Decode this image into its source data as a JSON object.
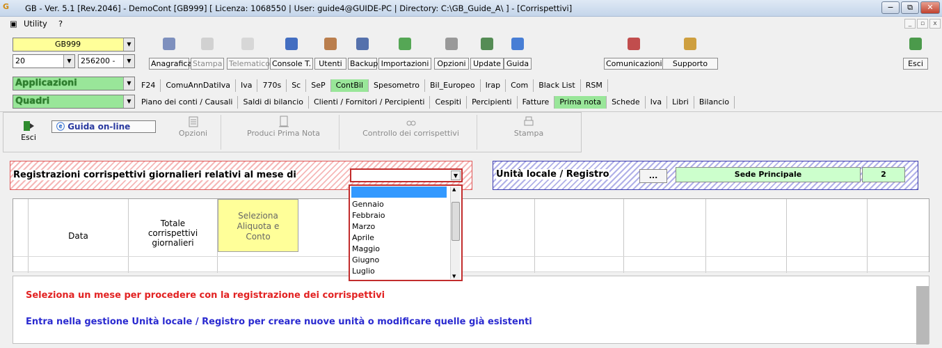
{
  "window": {
    "title": "GB - Ver. 5.1 [Rev.2046] -  DemoCont [GB999]     [ Licenza: 1068550 | User: guide4@GUIDE-PC | Directory: C:\\GB_Guide_A\\ ] - [Corrispettivi]",
    "app_icon_text": "G",
    "minimize": "−",
    "maximize": "⧉",
    "close": "✕"
  },
  "menubar": {
    "utility": "Utility",
    "help": "?"
  },
  "selectors": {
    "company": "GB999",
    "year": "20",
    "code": "256200 -",
    "applicazioni": "Applicazioni",
    "quadri": "Quadri"
  },
  "toolbar": [
    {
      "label": "Anagrafica",
      "icon": "address-book-icon",
      "state": "enabled"
    },
    {
      "label": "Stampa",
      "icon": "printer-icon",
      "state": "disabled"
    },
    {
      "label": "Telematico",
      "icon": "send-icon",
      "state": "disabled"
    },
    {
      "label": "Console T.",
      "icon": "console-icon",
      "state": "enabled"
    },
    {
      "label": "Utenti",
      "icon": "users-icon",
      "state": "enabled"
    },
    {
      "label": "Backup",
      "icon": "backup-icon",
      "state": "enabled"
    },
    {
      "label": "Importazioni",
      "icon": "import-icon",
      "state": "enabled"
    },
    {
      "label": "Opzioni",
      "icon": "wrench-icon",
      "state": "enabled"
    },
    {
      "label": "Update",
      "icon": "update-icon",
      "state": "enabled"
    },
    {
      "label": "Guida",
      "icon": "help-icon",
      "state": "enabled"
    },
    {
      "label": "Comunicazioni",
      "icon": "communication-icon",
      "state": "enabled"
    },
    {
      "label": "Supporto",
      "icon": "support-icon",
      "state": "enabled"
    },
    {
      "label": "Esci",
      "icon": "exit-icon",
      "state": "enabled"
    }
  ],
  "app_tabs": [
    "F24",
    "ComuAnnDatiIva",
    "Iva",
    "770s",
    "Sc",
    "SeP",
    "ContBil",
    "Spesometro",
    "Bil_Europeo",
    "Irap",
    "Com",
    "Black List",
    "RSM"
  ],
  "app_tabs_active": "ContBil",
  "quadri_tabs": [
    "Piano dei conti / Causali",
    "Saldi di bilancio",
    "Clienti / Fornitori / Percipienti",
    "Cespiti",
    "Percipienti",
    "Fatture",
    "Prima nota",
    "Schede",
    "Iva",
    "Libri",
    "Bilancio"
  ],
  "quadri_tabs_active": "Prima nota",
  "subtoolbar": {
    "esci": "Esci",
    "guida_online": "Guida on-line",
    "opzioni": "Opzioni",
    "produci": "Produci Prima Nota",
    "controllo": "Controllo dei corrispettivi",
    "stampa": "Stampa"
  },
  "filters": {
    "month_label": "Registrazioni corrispettivi giornalieri relativi al mese di",
    "month_value": "",
    "unit_label": "Unità locale / Registro",
    "unit_button": "...",
    "unit_name": "Sede Principale",
    "unit_number": "2"
  },
  "grid": {
    "headers": [
      "Data",
      "Totale corrispettivi giornalieri",
      "Seleziona Aliquota e Conto"
    ]
  },
  "month_options": [
    "",
    "Gennaio",
    "Febbraio",
    "Marzo",
    "Aprile",
    "Maggio",
    "Giugno",
    "Luglio"
  ],
  "messages": {
    "line1": "Seleziona un mese per procedere con la registrazione dei corrispettivi",
    "line2": "Entra nella gestione Unità locale / Registro per creare nuove unità o modificare quelle già esistenti"
  }
}
